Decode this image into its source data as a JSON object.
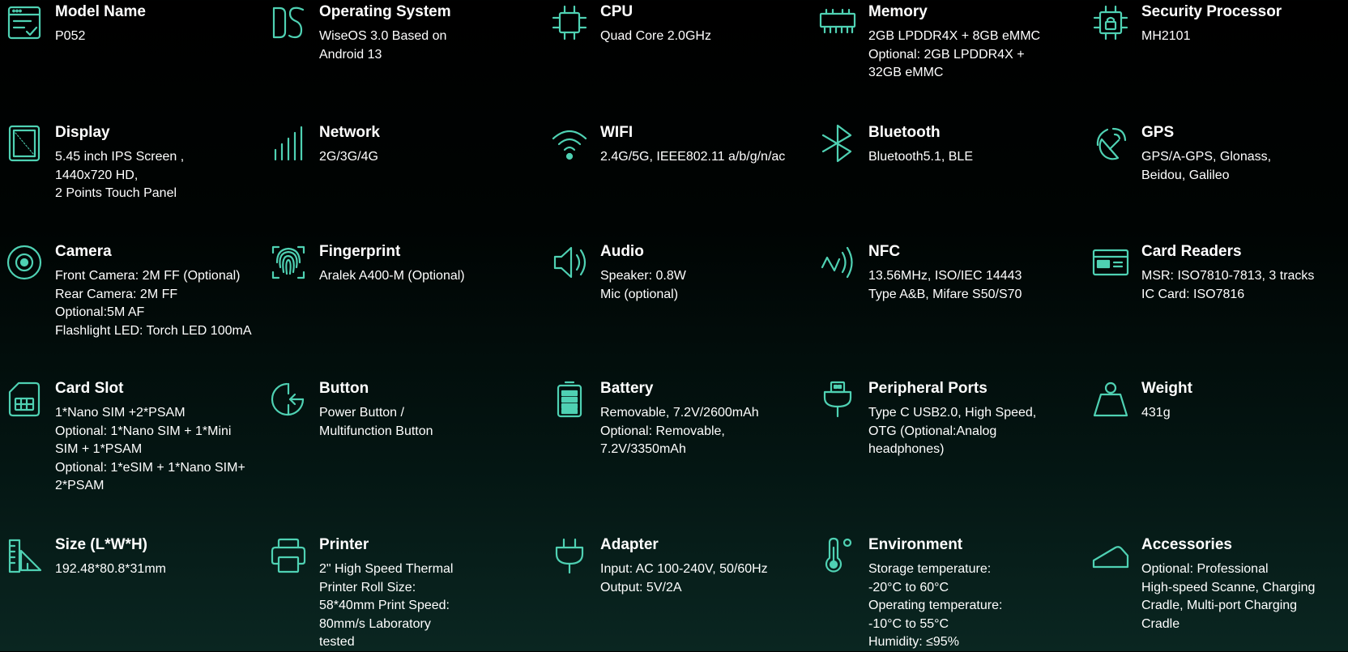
{
  "accent_color": "#4fd1b3",
  "specs": [
    {
      "icon": "form-check-icon",
      "title": "Model Name",
      "lines": [
        "P052"
      ]
    },
    {
      "icon": "os-logo-icon",
      "title": "Operating System",
      "lines": [
        "WiseOS 3.0 Based on",
        "Android 13"
      ]
    },
    {
      "icon": "cpu-chip-icon",
      "title": "CPU",
      "lines": [
        "Quad Core 2.0GHz"
      ]
    },
    {
      "icon": "memory-module-icon",
      "title": "Memory",
      "lines": [
        "2GB LPDDR4X + 8GB eMMC",
        "Optional: 2GB LPDDR4X +",
        "32GB eMMC"
      ]
    },
    {
      "icon": "secure-chip-icon",
      "title": "Security Processor",
      "lines": [
        "MH2101"
      ]
    },
    {
      "icon": "display-screen-icon",
      "title": "Display",
      "lines": [
        "5.45 inch IPS Screen ,",
        "1440x720 HD,",
        "2 Points Touch Panel"
      ]
    },
    {
      "icon": "signal-bars-icon",
      "title": "Network",
      "lines": [
        "2G/3G/4G"
      ]
    },
    {
      "icon": "wifi-icon",
      "title": "WIFI",
      "lines": [
        "2.4G/5G, IEEE802.11 a/b/g/n/ac"
      ]
    },
    {
      "icon": "bluetooth-icon",
      "title": "Bluetooth",
      "lines": [
        "Bluetooth5.1, BLE"
      ]
    },
    {
      "icon": "satellite-dish-icon",
      "title": "GPS",
      "lines": [
        "GPS/A-GPS, Glonass,",
        "Beidou, Galileo"
      ]
    },
    {
      "icon": "camera-lens-icon",
      "title": "Camera",
      "lines": [
        "Front Camera: 2M FF (Optional)",
        "Rear Camera: 2M FF",
        "Optional:5M AF",
        "Flashlight LED: Torch LED 100mA"
      ]
    },
    {
      "icon": "fingerprint-icon",
      "title": "Fingerprint",
      "lines": [
        "Aralek A400-M (Optional)"
      ]
    },
    {
      "icon": "speaker-icon",
      "title": "Audio",
      "lines": [
        "Speaker: 0.8W",
        "Mic (optional)"
      ]
    },
    {
      "icon": "nfc-icon",
      "title": "NFC",
      "lines": [
        "13.56MHz, ISO/IEC 14443",
        "Type A&B, Mifare S50/S70"
      ]
    },
    {
      "icon": "card-reader-icon",
      "title": "Card Readers",
      "lines": [
        "MSR: ISO7810-7813, 3 tracks",
        "IC Card: ISO7816"
      ]
    },
    {
      "icon": "sim-card-icon",
      "title": "Card Slot",
      "lines": [
        "1*Nano SIM +2*PSAM",
        "Optional: 1*Nano SIM + 1*Mini",
        "SIM + 1*PSAM",
        "Optional: 1*eSIM + 1*Nano SIM+",
        "2*PSAM"
      ]
    },
    {
      "icon": "power-button-icon",
      "title": "Button",
      "lines": [
        "Power Button /",
        "Multifunction Button"
      ]
    },
    {
      "icon": "battery-icon",
      "title": "Battery",
      "lines": [
        "Removable, 7.2V/2600mAh",
        "Optional: Removable,",
        "7.2V/3350mAh"
      ]
    },
    {
      "icon": "usb-plug-icon",
      "title": "Peripheral Ports",
      "lines": [
        "Type C USB2.0, High Speed,",
        "OTG (Optional:Analog",
        "headphones)"
      ]
    },
    {
      "icon": "weight-icon",
      "title": "Weight",
      "lines": [
        "431g"
      ]
    },
    {
      "icon": "ruler-triangle-icon",
      "title": "Size (L*W*H)",
      "lines": [
        "192.48*80.8*31mm"
      ]
    },
    {
      "icon": "printer-icon",
      "title": "Printer",
      "lines": [
        "2\" High Speed Thermal",
        "Printer Roll Size:",
        "58*40mm Print Speed:",
        "80mm/s Laboratory",
        "tested"
      ]
    },
    {
      "icon": "power-plug-icon",
      "title": "Adapter",
      "lines": [
        "Input: AC 100-240V, 50/60Hz",
        "Output: 5V/2A"
      ]
    },
    {
      "icon": "thermometer-icon",
      "title": "Environment",
      "lines": [
        "Storage temperature:",
        "-20°C to 60°C",
        "Operating temperature:",
        "-10°C to 55°C",
        "Humidity: ≤95%"
      ]
    },
    {
      "icon": "cradle-icon",
      "title": "Accessories",
      "lines": [
        "Optional: Professional",
        "High-speed Scanne, Charging",
        "Cradle, Multi-port Charging",
        "Cradle"
      ]
    }
  ]
}
